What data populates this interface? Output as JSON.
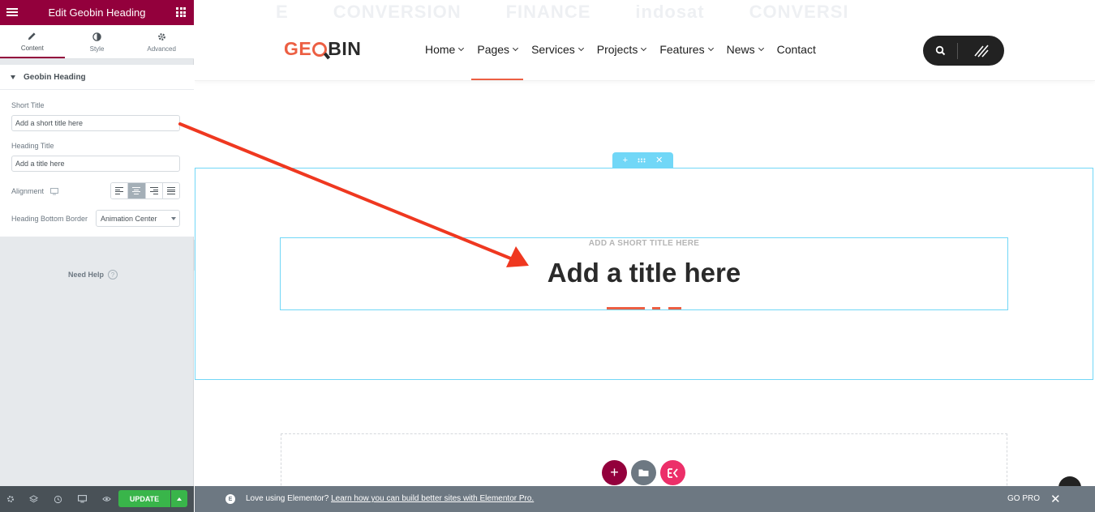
{
  "panel": {
    "title": "Edit Geobin Heading",
    "tabs": [
      {
        "label": "Content",
        "icon": "pencil-icon"
      },
      {
        "label": "Style",
        "icon": "contrast-icon"
      },
      {
        "label": "Advanced",
        "icon": "gear-icon"
      }
    ],
    "section_title": "Geobin Heading",
    "short_title_label": "Short Title",
    "short_title_value": "Add a short title here",
    "heading_title_label": "Heading Title",
    "heading_title_value": "Add a title here",
    "alignment_label": "Alignment",
    "alignment_selected": "center",
    "bottom_border_label": "Heading Bottom Border",
    "bottom_border_value": "Animation Center",
    "need_help": "Need Help",
    "update_label": "UPDATE",
    "footer_icons": [
      "settings-icon",
      "layers-icon",
      "history-icon",
      "responsive-icon",
      "preview-eye-icon"
    ]
  },
  "site": {
    "logo": {
      "part1": "GE",
      "part2": "BIN"
    },
    "nav": [
      {
        "label": "Home",
        "dropdown": true
      },
      {
        "label": "Pages",
        "dropdown": true,
        "active": true
      },
      {
        "label": "Services",
        "dropdown": true
      },
      {
        "label": "Projects",
        "dropdown": true
      },
      {
        "label": "Features",
        "dropdown": true
      },
      {
        "label": "News",
        "dropdown": true
      },
      {
        "label": "Contact",
        "dropdown": false
      }
    ],
    "faded_logos": [
      "E",
      "CONVERSION",
      "FINANCE",
      "indosat",
      "CONVERSI"
    ]
  },
  "widget": {
    "short_title": "ADD A SHORT TITLE HERE",
    "title": "Add a title here"
  },
  "notice": {
    "message": "Love using Elementor?",
    "link": "Learn how you can build better sites with Elementor Pro.",
    "go_pro": "GO PRO"
  },
  "colors": {
    "brand": "#93003c",
    "accent": "#ec5f43",
    "editor_outline": "#71d7f7",
    "update_green": "#39b54a"
  }
}
